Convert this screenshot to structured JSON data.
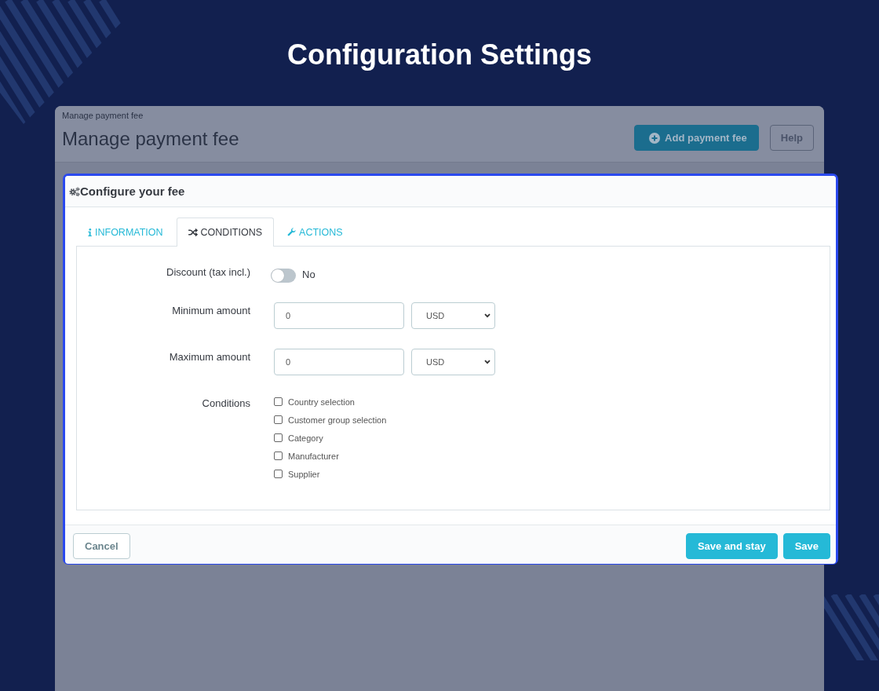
{
  "title": "Configuration Settings",
  "admin_page": {
    "breadcrumb": "Manage payment fee",
    "heading": "Manage payment fee",
    "buttons": [
      {
        "label": "Add payment fee",
        "kind": "primary"
      },
      {
        "label": "Help",
        "kind": "outline"
      }
    ]
  },
  "dialog": {
    "title": "Configure your fee",
    "tabs": [
      {
        "label": "INFORMATION",
        "selected": false
      },
      {
        "label": "CONDITIONS",
        "selected": true
      },
      {
        "label": "ACTIONS",
        "selected": false
      }
    ],
    "fields": [
      {
        "kind": "toggle",
        "label": "Discount (tax incl.)",
        "on": false,
        "state_label": "No"
      },
      {
        "kind": "amount",
        "label": "Minimum amount",
        "value": "0",
        "currency": "USD"
      },
      {
        "kind": "amount",
        "label": "Maximum amount",
        "value": "0",
        "currency": "USD"
      },
      {
        "kind": "checklist",
        "label": "Conditions",
        "options": [
          {
            "label": "Country selection",
            "checked": false
          },
          {
            "label": "Customer group selection",
            "checked": false
          },
          {
            "label": "Category",
            "checked": false
          },
          {
            "label": "Manufacturer",
            "checked": false
          },
          {
            "label": "Supplier",
            "checked": false
          }
        ]
      }
    ],
    "footer_buttons": [
      {
        "label": "Cancel",
        "kind": "secondary"
      },
      {
        "label": "Save and stay",
        "kind": "primary"
      },
      {
        "label": "Save",
        "kind": "primary"
      }
    ]
  }
}
